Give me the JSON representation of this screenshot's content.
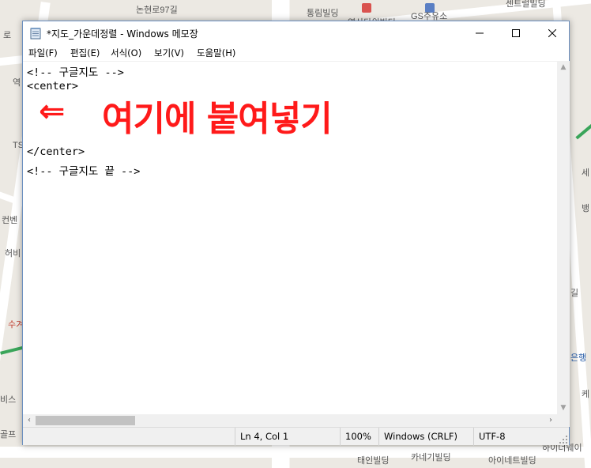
{
  "map": {
    "labels": [
      {
        "text": "논현로97길",
        "cls": "dark"
      },
      {
        "text": "통림빌딩",
        "cls": "dark"
      },
      {
        "text": "영산타워빌딩",
        "cls": "dark"
      },
      {
        "text": "GS주유소",
        "cls": "dark"
      },
      {
        "text": "센트럴빌딩",
        "cls": "dark"
      },
      {
        "text": "로",
        "cls": ""
      },
      {
        "text": "역",
        "cls": ""
      },
      {
        "text": "TS",
        "cls": ""
      },
      {
        "text": "컨벤",
        "cls": "dark"
      },
      {
        "text": "허비",
        "cls": ""
      },
      {
        "text": "수겨",
        "cls": "red"
      },
      {
        "text": "비스",
        "cls": ""
      },
      {
        "text": "골프",
        "cls": "dark"
      },
      {
        "text": "세",
        "cls": ""
      },
      {
        "text": "뱅",
        "cls": ""
      },
      {
        "text": "길",
        "cls": ""
      },
      {
        "text": "은행",
        "cls": "blue"
      },
      {
        "text": "케",
        "cls": ""
      },
      {
        "text": "태인빌딩",
        "cls": "dark"
      },
      {
        "text": "카네기빌딩",
        "cls": "dark"
      },
      {
        "text": "아이네트빌딩",
        "cls": "dark"
      },
      {
        "text": "하이너웨이",
        "cls": ""
      }
    ]
  },
  "window": {
    "title": "*지도_가운데정렬 - Windows 메모장",
    "controls": {
      "minimize": "minimize",
      "maximize": "maximize",
      "close": "close"
    }
  },
  "menu": [
    "파일(F)",
    "편집(E)",
    "서식(O)",
    "보기(V)",
    "도움말(H)"
  ],
  "editor": {
    "lines": [
      "<!-- 구글지도 -->",
      "<center>",
      "",
      "",
      "</center>",
      "<!-- 구글지도 끝 -->"
    ],
    "overlay_arrow": "⇐",
    "overlay_text": "여기에 붙여넣기"
  },
  "status": {
    "position": "Ln 4, Col 1",
    "zoom": "100%",
    "line_ending": "Windows (CRLF)",
    "encoding": "UTF-8"
  }
}
